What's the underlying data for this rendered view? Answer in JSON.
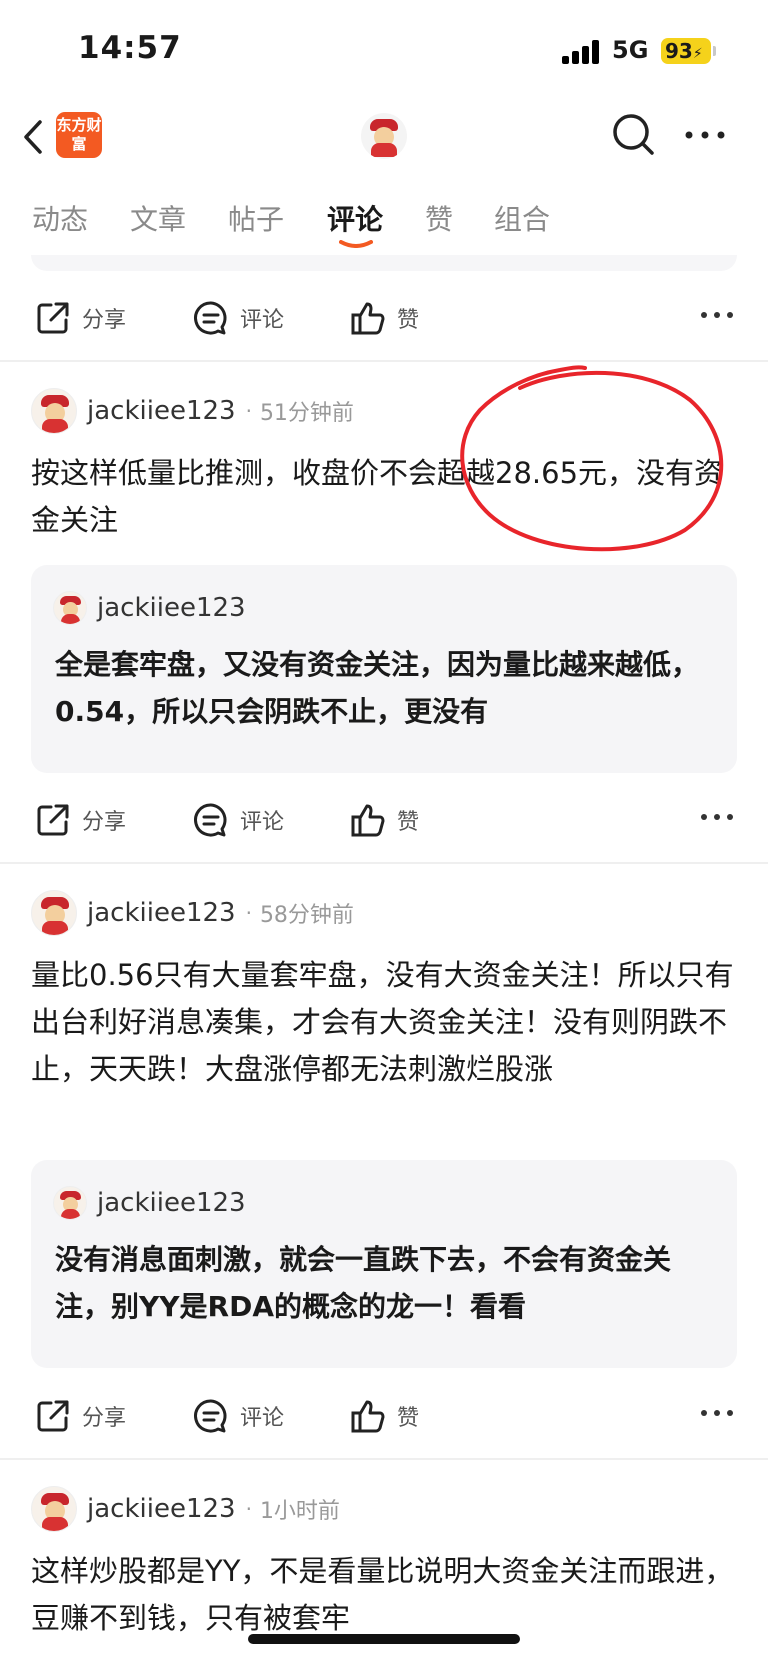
{
  "status_bar": {
    "time": "14:57",
    "network": "5G",
    "battery": "93"
  },
  "nav": {
    "logo_text": "东方财富"
  },
  "tabs": [
    {
      "label": "动态"
    },
    {
      "label": "文章"
    },
    {
      "label": "帖子"
    },
    {
      "label": "评论",
      "active": true
    },
    {
      "label": "赞"
    },
    {
      "label": "组合"
    }
  ],
  "actions": {
    "share": "分享",
    "comment": "评论",
    "like": "赞"
  },
  "posts": [
    {
      "username": "jackiiee123",
      "time_ago": "51分钟前",
      "text": "按这样低量比推测，收盘价不会超越28.65元，没有资金关注",
      "reply": {
        "username": "jackiiee123",
        "text": "全是套牢盘，又没有资金关注，因为量比越来越低，0.54，所以只会阴跌不止，更没有"
      }
    },
    {
      "username": "jackiiee123",
      "time_ago": "58分钟前",
      "text": "量比0.56只有大量套牢盘，没有大资金关注！所以只有出台利好消息凑集，才会有大资金关注！没有则阴跌不止，天天跌！大盘涨停都无法刺激烂股涨",
      "reply": {
        "username": "jackiiee123",
        "text": "没有消息面刺激，就会一直跌下去，不会有资金关注，别YY是RDA的概念的龙一！看看"
      }
    },
    {
      "username": "jackiiee123",
      "time_ago": "1小时前",
      "text": "这样炒股都是YY，不是看量比说明大资金关注而跟进，豆赚不到钱，只有被套牢"
    }
  ],
  "colors": {
    "accent": "#f35a22",
    "annotation": "#e8252b"
  }
}
